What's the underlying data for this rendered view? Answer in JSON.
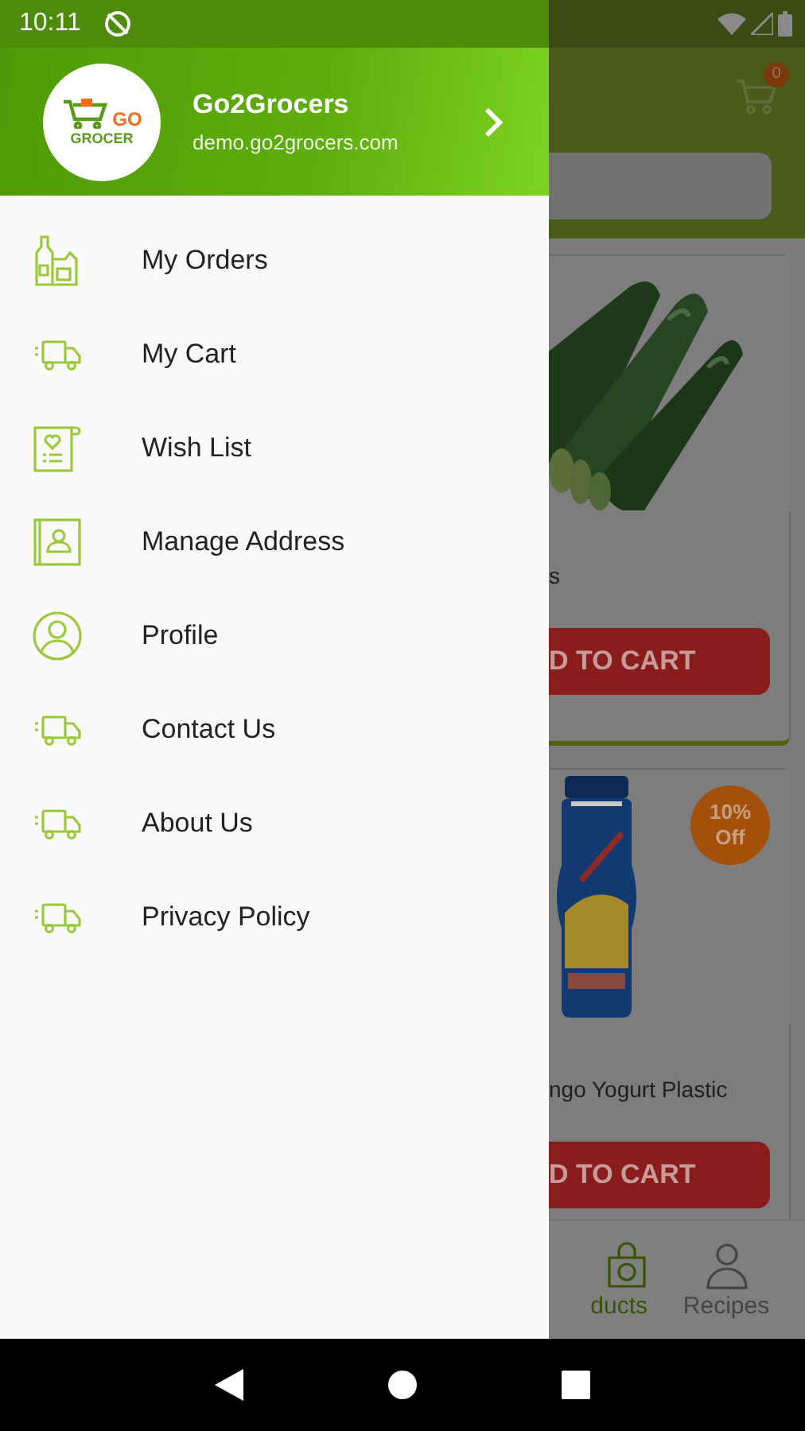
{
  "status_bar": {
    "time": "10:11"
  },
  "drawer": {
    "logo": {
      "line_1": "GO",
      "line_2": "GROCER"
    },
    "title": "Go2Grocers",
    "subtitle": "demo.go2grocers.com",
    "menu": [
      {
        "label": "My Orders"
      },
      {
        "label": "My Cart"
      },
      {
        "label": "Wish List"
      },
      {
        "label": "Manage Address"
      },
      {
        "label": "Profile"
      },
      {
        "label": "Contact Us"
      },
      {
        "label": "About Us"
      },
      {
        "label": "Privacy Policy"
      }
    ]
  },
  "page": {
    "cart_badge": "0",
    "cards": [
      {
        "name": "s",
        "button": "D TO CART"
      },
      {
        "badge": "10% Off",
        "name": "ngo Yogurt Plastic",
        "button": "D TO CART"
      }
    ],
    "bottom_nav": [
      {
        "label": "ducts",
        "selected": true
      },
      {
        "label": "Recipes",
        "selected": false
      }
    ]
  }
}
